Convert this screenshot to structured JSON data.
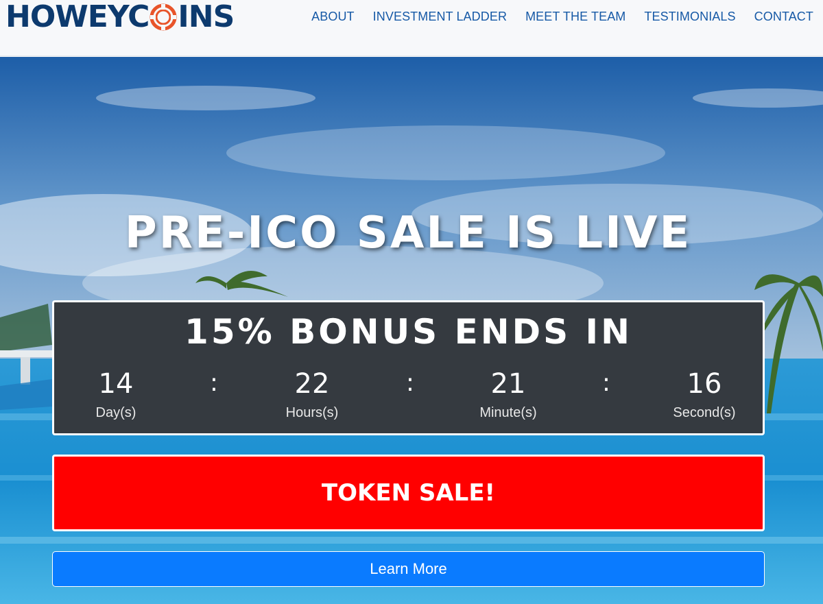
{
  "brand": {
    "name_before": "HOWEYC",
    "name_after": "INS",
    "colors": {
      "navy": "#0d3a6e",
      "orange": "#e8542a",
      "nav_link": "#1659a6"
    }
  },
  "nav": {
    "items": [
      {
        "label": "ABOUT"
      },
      {
        "label": "INVESTMENT LADDER"
      },
      {
        "label": "MEET THE TEAM"
      },
      {
        "label": "TESTIMONIALS"
      },
      {
        "label": "CONTACT"
      }
    ]
  },
  "hero": {
    "headline": "PRE-ICO SALE IS LIVE",
    "countdown": {
      "title": "15% BONUS ENDS IN",
      "separator": ":",
      "units": [
        {
          "value": "14",
          "label": "Day(s)"
        },
        {
          "value": "22",
          "label": "Hours(s)"
        },
        {
          "value": "21",
          "label": "Minute(s)"
        },
        {
          "value": "16",
          "label": "Second(s)"
        }
      ],
      "colors": {
        "background": "#353a40"
      }
    },
    "token_sale_label": "TOKEN SALE!",
    "learn_more_label": "Learn More",
    "colors": {
      "token_button": "#ff0000",
      "learn_button": "#0a7bff"
    }
  }
}
